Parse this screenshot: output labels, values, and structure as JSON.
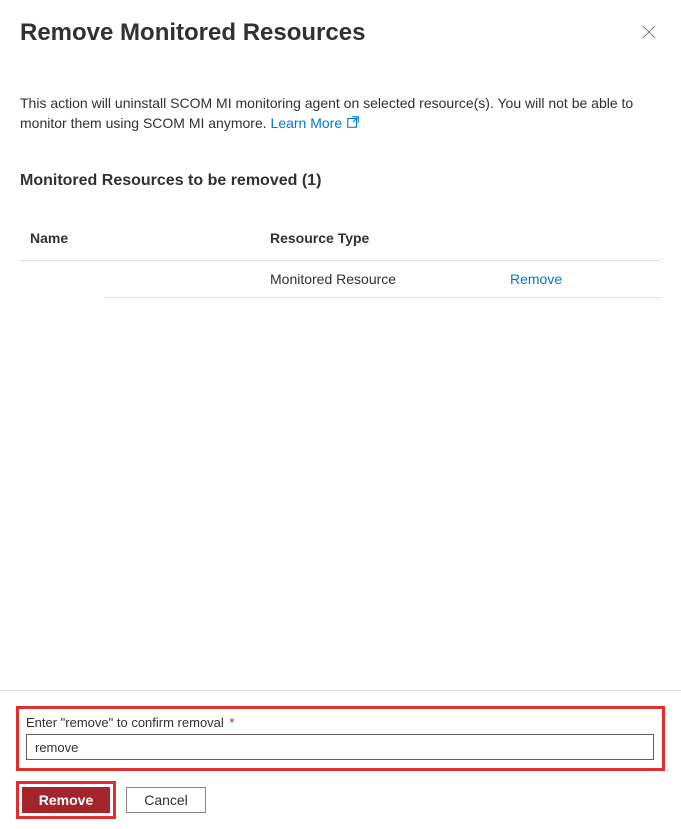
{
  "header": {
    "title": "Remove Monitored Resources"
  },
  "description": {
    "text": "This action will uninstall SCOM MI monitoring agent on selected resource(s). You will not be able to monitor them using SCOM MI anymore. ",
    "learn_more_label": "Learn More"
  },
  "section": {
    "title": "Monitored Resources to be removed (1)"
  },
  "table": {
    "columns": {
      "name": "Name",
      "type": "Resource Type"
    },
    "rows": [
      {
        "name": "",
        "type": "Monitored Resource",
        "action": "Remove"
      }
    ]
  },
  "confirm": {
    "label": "Enter \"remove\" to confirm removal",
    "value": "remove"
  },
  "buttons": {
    "remove": "Remove",
    "cancel": "Cancel"
  }
}
